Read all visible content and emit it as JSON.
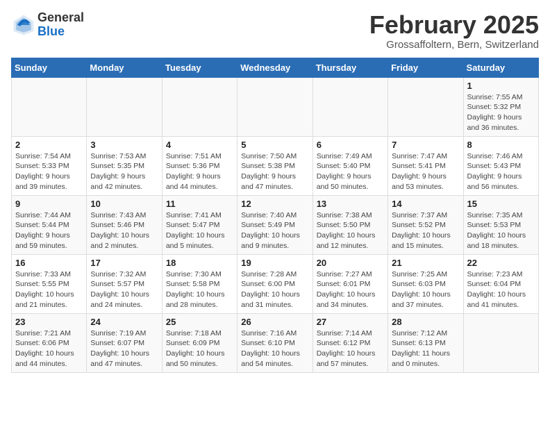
{
  "header": {
    "logo": {
      "general": "General",
      "blue": "Blue"
    },
    "month": "February 2025",
    "location": "Grossaffoltern, Bern, Switzerland"
  },
  "weekdays": [
    "Sunday",
    "Monday",
    "Tuesday",
    "Wednesday",
    "Thursday",
    "Friday",
    "Saturday"
  ],
  "weeks": [
    [
      null,
      null,
      null,
      null,
      null,
      null,
      {
        "day": "1",
        "sunrise": "Sunrise: 7:55 AM",
        "sunset": "Sunset: 5:32 PM",
        "daylight": "Daylight: 9 hours and 36 minutes."
      }
    ],
    [
      {
        "day": "2",
        "sunrise": "Sunrise: 7:54 AM",
        "sunset": "Sunset: 5:33 PM",
        "daylight": "Daylight: 9 hours and 39 minutes."
      },
      {
        "day": "3",
        "sunrise": "Sunrise: 7:53 AM",
        "sunset": "Sunset: 5:35 PM",
        "daylight": "Daylight: 9 hours and 42 minutes."
      },
      {
        "day": "4",
        "sunrise": "Sunrise: 7:51 AM",
        "sunset": "Sunset: 5:36 PM",
        "daylight": "Daylight: 9 hours and 44 minutes."
      },
      {
        "day": "5",
        "sunrise": "Sunrise: 7:50 AM",
        "sunset": "Sunset: 5:38 PM",
        "daylight": "Daylight: 9 hours and 47 minutes."
      },
      {
        "day": "6",
        "sunrise": "Sunrise: 7:49 AM",
        "sunset": "Sunset: 5:40 PM",
        "daylight": "Daylight: 9 hours and 50 minutes."
      },
      {
        "day": "7",
        "sunrise": "Sunrise: 7:47 AM",
        "sunset": "Sunset: 5:41 PM",
        "daylight": "Daylight: 9 hours and 53 minutes."
      },
      {
        "day": "8",
        "sunrise": "Sunrise: 7:46 AM",
        "sunset": "Sunset: 5:43 PM",
        "daylight": "Daylight: 9 hours and 56 minutes."
      }
    ],
    [
      {
        "day": "9",
        "sunrise": "Sunrise: 7:44 AM",
        "sunset": "Sunset: 5:44 PM",
        "daylight": "Daylight: 9 hours and 59 minutes."
      },
      {
        "day": "10",
        "sunrise": "Sunrise: 7:43 AM",
        "sunset": "Sunset: 5:46 PM",
        "daylight": "Daylight: 10 hours and 2 minutes."
      },
      {
        "day": "11",
        "sunrise": "Sunrise: 7:41 AM",
        "sunset": "Sunset: 5:47 PM",
        "daylight": "Daylight: 10 hours and 5 minutes."
      },
      {
        "day": "12",
        "sunrise": "Sunrise: 7:40 AM",
        "sunset": "Sunset: 5:49 PM",
        "daylight": "Daylight: 10 hours and 9 minutes."
      },
      {
        "day": "13",
        "sunrise": "Sunrise: 7:38 AM",
        "sunset": "Sunset: 5:50 PM",
        "daylight": "Daylight: 10 hours and 12 minutes."
      },
      {
        "day": "14",
        "sunrise": "Sunrise: 7:37 AM",
        "sunset": "Sunset: 5:52 PM",
        "daylight": "Daylight: 10 hours and 15 minutes."
      },
      {
        "day": "15",
        "sunrise": "Sunrise: 7:35 AM",
        "sunset": "Sunset: 5:53 PM",
        "daylight": "Daylight: 10 hours and 18 minutes."
      }
    ],
    [
      {
        "day": "16",
        "sunrise": "Sunrise: 7:33 AM",
        "sunset": "Sunset: 5:55 PM",
        "daylight": "Daylight: 10 hours and 21 minutes."
      },
      {
        "day": "17",
        "sunrise": "Sunrise: 7:32 AM",
        "sunset": "Sunset: 5:57 PM",
        "daylight": "Daylight: 10 hours and 24 minutes."
      },
      {
        "day": "18",
        "sunrise": "Sunrise: 7:30 AM",
        "sunset": "Sunset: 5:58 PM",
        "daylight": "Daylight: 10 hours and 28 minutes."
      },
      {
        "day": "19",
        "sunrise": "Sunrise: 7:28 AM",
        "sunset": "Sunset: 6:00 PM",
        "daylight": "Daylight: 10 hours and 31 minutes."
      },
      {
        "day": "20",
        "sunrise": "Sunrise: 7:27 AM",
        "sunset": "Sunset: 6:01 PM",
        "daylight": "Daylight: 10 hours and 34 minutes."
      },
      {
        "day": "21",
        "sunrise": "Sunrise: 7:25 AM",
        "sunset": "Sunset: 6:03 PM",
        "daylight": "Daylight: 10 hours and 37 minutes."
      },
      {
        "day": "22",
        "sunrise": "Sunrise: 7:23 AM",
        "sunset": "Sunset: 6:04 PM",
        "daylight": "Daylight: 10 hours and 41 minutes."
      }
    ],
    [
      {
        "day": "23",
        "sunrise": "Sunrise: 7:21 AM",
        "sunset": "Sunset: 6:06 PM",
        "daylight": "Daylight: 10 hours and 44 minutes."
      },
      {
        "day": "24",
        "sunrise": "Sunrise: 7:19 AM",
        "sunset": "Sunset: 6:07 PM",
        "daylight": "Daylight: 10 hours and 47 minutes."
      },
      {
        "day": "25",
        "sunrise": "Sunrise: 7:18 AM",
        "sunset": "Sunset: 6:09 PM",
        "daylight": "Daylight: 10 hours and 50 minutes."
      },
      {
        "day": "26",
        "sunrise": "Sunrise: 7:16 AM",
        "sunset": "Sunset: 6:10 PM",
        "daylight": "Daylight: 10 hours and 54 minutes."
      },
      {
        "day": "27",
        "sunrise": "Sunrise: 7:14 AM",
        "sunset": "Sunset: 6:12 PM",
        "daylight": "Daylight: 10 hours and 57 minutes."
      },
      {
        "day": "28",
        "sunrise": "Sunrise: 7:12 AM",
        "sunset": "Sunset: 6:13 PM",
        "daylight": "Daylight: 11 hours and 0 minutes."
      },
      null
    ]
  ]
}
